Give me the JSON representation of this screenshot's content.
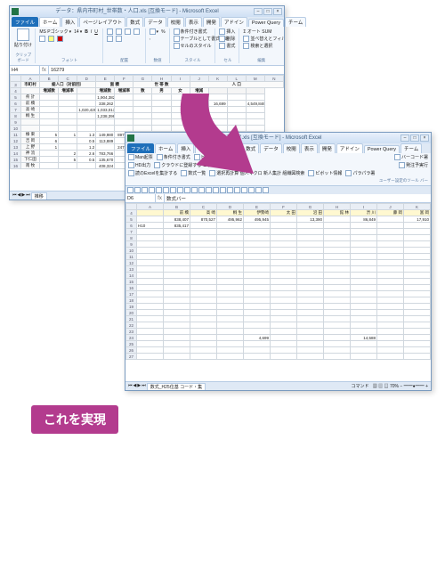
{
  "win1": {
    "title": "データ：県内市町村_世帯数・人口.xls [互換モード] - Microsoft Excel",
    "tabs": [
      "ファイル",
      "ホーム",
      "挿入",
      "ページレイアウト",
      "数式",
      "データ",
      "校閲",
      "表示",
      "開発",
      "アドイン",
      "Power Query",
      "チーム"
    ],
    "ribbon": {
      "paste": "貼り付け",
      "font_label": "MS Pゴシック",
      "font_size": "14",
      "groups": [
        "クリップボード",
        "フォント",
        "配置",
        "数値",
        "スタイル",
        "セル",
        "編集"
      ],
      "style_items": [
        "条件付き書式",
        "テーブルとして書式設定",
        "セルのスタイル"
      ],
      "cell_items": [
        "挿入",
        "削除",
        "書式"
      ],
      "edit_items": [
        "Σ オート SUM",
        "フィル",
        "クリア",
        "並べ替えとフィルター",
        "検索と選択"
      ]
    },
    "name_box": "H4",
    "formula": "16279",
    "col_letters": [
      "A",
      "B",
      "C",
      "D",
      "E",
      "F",
      "G",
      "H",
      "I",
      "J",
      "K",
      "L",
      "M",
      "N"
    ],
    "header1": [
      "市町村",
      "総人口（対前回）",
      "面  積",
      "世  帯  数",
      "人      口"
    ],
    "header2": [
      "",
      "増減数",
      "増減率",
      "",
      "増減数",
      "増減率",
      "数",
      "男",
      "女",
      "増減"
    ],
    "rows": [
      [
        "県  計",
        "",
        "",
        "",
        "1,904,382",
        "",
        "",
        "",
        "",
        "776,098",
        "",
        "",
        ""
      ],
      [
        "前  橋",
        "",
        "",
        "",
        "338,262",
        "",
        "",
        "",
        "",
        "",
        "16,699",
        "",
        "4,549,846"
      ],
      [
        "高  崎",
        "",
        "",
        "1,020,428",
        "1,033,013",
        "",
        "",
        "",
        "",
        "54",
        "",
        "",
        ""
      ],
      [
        "桐  生",
        "",
        "",
        "",
        "1,238,398",
        "",
        "",
        "",
        "",
        "",
        "",
        "",
        ""
      ],
      [
        "",
        "",
        "",
        "",
        "",
        "",
        "",
        "",
        "",
        "",
        "",
        "",
        ""
      ],
      [
        "",
        "",
        "",
        "",
        "",
        "",
        "",
        "",
        "",
        "",
        "",
        "",
        ""
      ],
      [
        "榛  東",
        "5",
        "1",
        "1.3",
        "149,980",
        "897,397",
        "",
        "",
        "",
        "",
        "29,4",
        "",
        ""
      ],
      [
        "吉  岡",
        "6",
        "",
        "0.5",
        "113,889",
        "",
        "",
        "",
        "",
        "",
        "",
        "",
        ""
      ],
      [
        "上  野",
        "1",
        "",
        "1.2",
        "",
        "247,702",
        "",
        "39,9",
        "",
        "",
        "",
        "",
        ""
      ],
      [
        "神  流",
        "",
        "2",
        "2.6",
        "783,766",
        "",
        "",
        "",
        "",
        "",
        "",
        "",
        ""
      ],
      [
        "下仁田",
        "",
        "5",
        "0.5",
        "135,670",
        "",
        "",
        "",
        "",
        "",
        "",
        "",
        ""
      ],
      [
        "南  牧",
        "",
        "",
        "",
        "408,324",
        "",
        "",
        "",
        "",
        "",
        "",
        "",
        ""
      ]
    ],
    "sheet_tab": "推移",
    "status": "コマンド"
  },
  "win2": {
    "title": "検算データ.xls [互換モード] - Microsoft Excel",
    "tabs": [
      "ファイル",
      "ホーム",
      "挿入",
      "ページレイアウト",
      "数式",
      "データ",
      "校閲",
      "表示",
      "開発",
      "アドイン",
      "Power Query",
      "チーム"
    ],
    "ribbon_rows": {
      "row1": [
        "Man起票",
        "条件付き書式",
        "ピボット情報",
        "バーコード署"
      ],
      "row2": [
        "HD出力",
        "クラウドに登録する ピボット情報",
        "発注予実行"
      ],
      "row3": [
        "読のExcelを集計する",
        "数式一覧",
        "選択再計算 個人マクロ 新人集計 組織図検索",
        "ピボット情報",
        "パラパラ署"
      ],
      "group": "ユーザー設定のツール バー"
    },
    "qat_count": 20,
    "name_box": "D6",
    "formula": "数式バー",
    "columns": [
      "",
      "A",
      "B",
      "C",
      "D",
      "E",
      "F",
      "G",
      "H",
      "I",
      "J",
      "K"
    ],
    "head": [
      "",
      "",
      "前  橋",
      "高  崎",
      "桐  生",
      "伊勢崎",
      "太  田",
      "沼  田",
      "館  林",
      "渋  川",
      "藤  岡",
      "富  岡"
    ],
    "rows": [
      [
        "5",
        "",
        "838,407",
        "870,527",
        "495,962",
        "495,945",
        "",
        "13,390",
        "",
        "86,849",
        "",
        "17,910"
      ],
      [
        "6",
        "H10",
        "835,417",
        "",
        "",
        "",
        "",
        "",
        "",
        "",
        "",
        ""
      ],
      [
        "7",
        "",
        "",
        "",
        "",
        "",
        "",
        "",
        "",
        "",
        "",
        ""
      ],
      [
        "8",
        "",
        "",
        "",
        "",
        "",
        "",
        "",
        "",
        "",
        "",
        ""
      ],
      [
        "9",
        "",
        "",
        "",
        "",
        "",
        "",
        "",
        "",
        "",
        "",
        ""
      ],
      [
        "10",
        "",
        "",
        "",
        "",
        "",
        "",
        "",
        "",
        "",
        "",
        ""
      ],
      [
        "11",
        "",
        "",
        "",
        "",
        "",
        "",
        "",
        "",
        "",
        "",
        ""
      ],
      [
        "12",
        "",
        "",
        "",
        "",
        "",
        "",
        "",
        "",
        "",
        "",
        ""
      ],
      [
        "13",
        "",
        "",
        "",
        "",
        "",
        "",
        "",
        "",
        "",
        "",
        ""
      ],
      [
        "14",
        "",
        "",
        "",
        "",
        "",
        "",
        "",
        "",
        "",
        "",
        ""
      ],
      [
        "15",
        "",
        "",
        "",
        "",
        "",
        "",
        "",
        "",
        "",
        "",
        ""
      ],
      [
        "16",
        "",
        "",
        "",
        "",
        "",
        "",
        "",
        "",
        "",
        "",
        ""
      ],
      [
        "17",
        "",
        "",
        "",
        "",
        "",
        "",
        "",
        "",
        "",
        "",
        ""
      ],
      [
        "18",
        "",
        "",
        "",
        "",
        "",
        "",
        "",
        "",
        "",
        "",
        ""
      ],
      [
        "19",
        "",
        "",
        "",
        "",
        "",
        "",
        "",
        "",
        "",
        "",
        ""
      ],
      [
        "20",
        "",
        "",
        "",
        "",
        "",
        "",
        "",
        "",
        "",
        "",
        ""
      ],
      [
        "21",
        "",
        "",
        "",
        "",
        "",
        "",
        "",
        "",
        "",
        "",
        ""
      ],
      [
        "22",
        "",
        "",
        "",
        "",
        "",
        "",
        "",
        "",
        "",
        "",
        ""
      ],
      [
        "23",
        "",
        "",
        "",
        "",
        "",
        "",
        "",
        "",
        "",
        "",
        ""
      ],
      [
        "24",
        "",
        "",
        "",
        "",
        "4,699",
        "",
        "",
        "",
        "14,588",
        "",
        ""
      ],
      [
        "25",
        "",
        "",
        "",
        "",
        "",
        "",
        "",
        "",
        "",
        "",
        ""
      ],
      [
        "26",
        "",
        "",
        "",
        "",
        "",
        "",
        "",
        "",
        "",
        "",
        ""
      ],
      [
        "27",
        "",
        "",
        "",
        "",
        "",
        "",
        "",
        "",
        "",
        "",
        ""
      ]
    ],
    "sheet_tab": "数式_H25住基 コード・集",
    "status_left": "コマンド",
    "zoom": "70%"
  },
  "badge": "これを実現"
}
